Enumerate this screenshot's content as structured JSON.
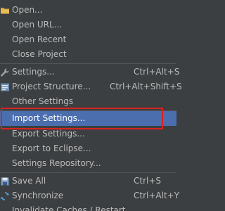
{
  "menu": {
    "items": [
      {
        "label": "Open...",
        "shortcut": "",
        "icon": "folder-icon"
      },
      {
        "label": "Open URL...",
        "shortcut": ""
      },
      {
        "label": "Open Recent",
        "shortcut": ""
      },
      {
        "label": "Close Project",
        "shortcut": ""
      },
      {
        "label": "Settings...",
        "shortcut": "Ctrl+Alt+S",
        "icon": "wrench-icon"
      },
      {
        "label": "Project Structure...",
        "shortcut": "Ctrl+Alt+Shift+S",
        "icon": "project-structure-icon"
      },
      {
        "label": "Other Settings",
        "shortcut": ""
      },
      {
        "label": "Import Settings...",
        "shortcut": "",
        "selected": true
      },
      {
        "label": "Export Settings...",
        "shortcut": ""
      },
      {
        "label": "Export to Eclipse...",
        "shortcut": ""
      },
      {
        "label": "Settings Repository...",
        "shortcut": ""
      },
      {
        "label": "Save All",
        "shortcut": "Ctrl+S",
        "icon": "save-icon"
      },
      {
        "label": "Synchronize",
        "shortcut": "Ctrl+Alt+Y",
        "icon": "sync-icon"
      },
      {
        "label": "Invalidate Caches / Restart...",
        "shortcut": ""
      }
    ]
  },
  "colors": {
    "menu_bg": "#3c3f41",
    "selected_bg": "#4b6eaf",
    "annotation_box": "#d9231f",
    "text": "#bbbbbb"
  }
}
